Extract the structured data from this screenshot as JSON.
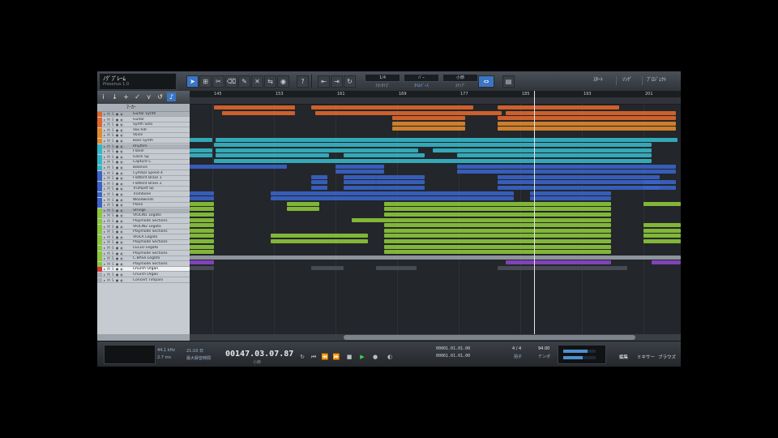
{
  "song": {
    "title": "ﾉｸﾞﾌﾟﾚｰﾑ",
    "subtitle": "Presonus 1.0",
    "version": "1.0.0"
  },
  "toolbar": {
    "modes": [
      {
        "top": "1/4",
        "bottom": "ｸｵﾝﾀｲｽﾞ",
        "on": false
      },
      {
        "top": "ﾊﾞｰ",
        "bottom": "ﾀｲﾑﾍﾞｰｽ",
        "on": true
      },
      {
        "top": "小節",
        "bottom": "ｽﾅｯﾌﾟ",
        "on": false
      }
    ],
    "views": [
      "ｽﾀｰﾄ",
      "ｿﾝｸﾞ",
      "ﾌﾟﾛｼﾞｪｸﾄ"
    ]
  },
  "left_panel": {
    "marker_label": "ﾏｰｶｰ"
  },
  "tracks": [
    {
      "name": "Guitar Synth",
      "color": "#e0672c",
      "type": "folder"
    },
    {
      "name": "Guitar",
      "color": "#e0672c",
      "type": "track"
    },
    {
      "name": "Synth Sola",
      "color": "#e0672c",
      "type": "track"
    },
    {
      "name": "Vox Rdr",
      "color": "#e08a2c",
      "type": "track"
    },
    {
      "name": "Voice",
      "color": "#e08a2c",
      "type": "track"
    },
    {
      "name": "Bass Synth",
      "color": "#e08a2c",
      "type": "track"
    },
    {
      "name": "Rhythm",
      "color": "#36b7c6",
      "type": "folder"
    },
    {
      "name": "Flanel",
      "color": "#36b7c6",
      "type": "track"
    },
    {
      "name": "Glock Sp",
      "color": "#36b7c6",
      "type": "track"
    },
    {
      "name": "Capture C",
      "color": "#36b7c6",
      "type": "track"
    },
    {
      "name": "Balance",
      "color": "#36b7c6",
      "type": "track"
    },
    {
      "name": "Cymbal Speed 4",
      "color": "#3a64c8",
      "type": "track"
    },
    {
      "name": "Flattent Brass 1",
      "color": "#3a64c8",
      "type": "track"
    },
    {
      "name": "Flattent Brass 2",
      "color": "#3a64c8",
      "type": "track"
    },
    {
      "name": "Trumpet Sp",
      "color": "#3a64c8",
      "type": "track"
    },
    {
      "name": "Trombone",
      "color": "#3a64c8",
      "type": "track"
    },
    {
      "name": "Woodwinds",
      "color": "#3a64c8",
      "type": "track"
    },
    {
      "name": "Piano",
      "color": "#3a64c8",
      "type": "track"
    },
    {
      "name": "Strings",
      "color": "#8cc63a",
      "type": "folder"
    },
    {
      "name": "VIOLIN1 Legato",
      "color": "#8cc63a",
      "type": "track"
    },
    {
      "name": "Playmode Sections",
      "color": "#8cc63a",
      "type": "track"
    },
    {
      "name": "VIOLIN2 Legato",
      "color": "#8cc63a",
      "type": "track"
    },
    {
      "name": "Playmode Sections",
      "color": "#8cc63a",
      "type": "track"
    },
    {
      "name": "VIOLA Legato",
      "color": "#8cc63a",
      "type": "track"
    },
    {
      "name": "Playmode Sections",
      "color": "#8cc63a",
      "type": "track"
    },
    {
      "name": "CELLO Legato",
      "color": "#8cc63a",
      "type": "track"
    },
    {
      "name": "Playmode Sections",
      "color": "#8cc63a",
      "type": "track"
    },
    {
      "name": "C.BASS Legato",
      "color": "#8cc63a",
      "type": "track"
    },
    {
      "name": "Playmode Sections",
      "color": "#8cc63a",
      "type": "track"
    },
    {
      "name": "Church Organ",
      "color": "#d43a3a",
      "type": "selected"
    },
    {
      "name": "Church Organ",
      "color": "#a7adb4",
      "type": "track"
    },
    {
      "name": "Concert Timpani",
      "color": "#a7adb4",
      "type": "track"
    }
  ],
  "ruler": [
    "145",
    "153",
    "161",
    "169",
    "177",
    "185",
    "193",
    "201"
  ],
  "transport": {
    "sample_rate": "44.1 kHz",
    "latency": "2.7 ms",
    "record_time": "21:10 日",
    "record_label": "最大録音時間",
    "time": "00147.03.07.87",
    "time_unit": "小節",
    "loop_start": "00001.01.01.00",
    "loop_end": "00061.01.01.00",
    "signature": "4 / 4",
    "signature_label": "拍子",
    "tempo": "94.00",
    "tempo_label": "テンポ",
    "views": [
      "編集",
      "ミキサー",
      "ブラウズ"
    ]
  }
}
